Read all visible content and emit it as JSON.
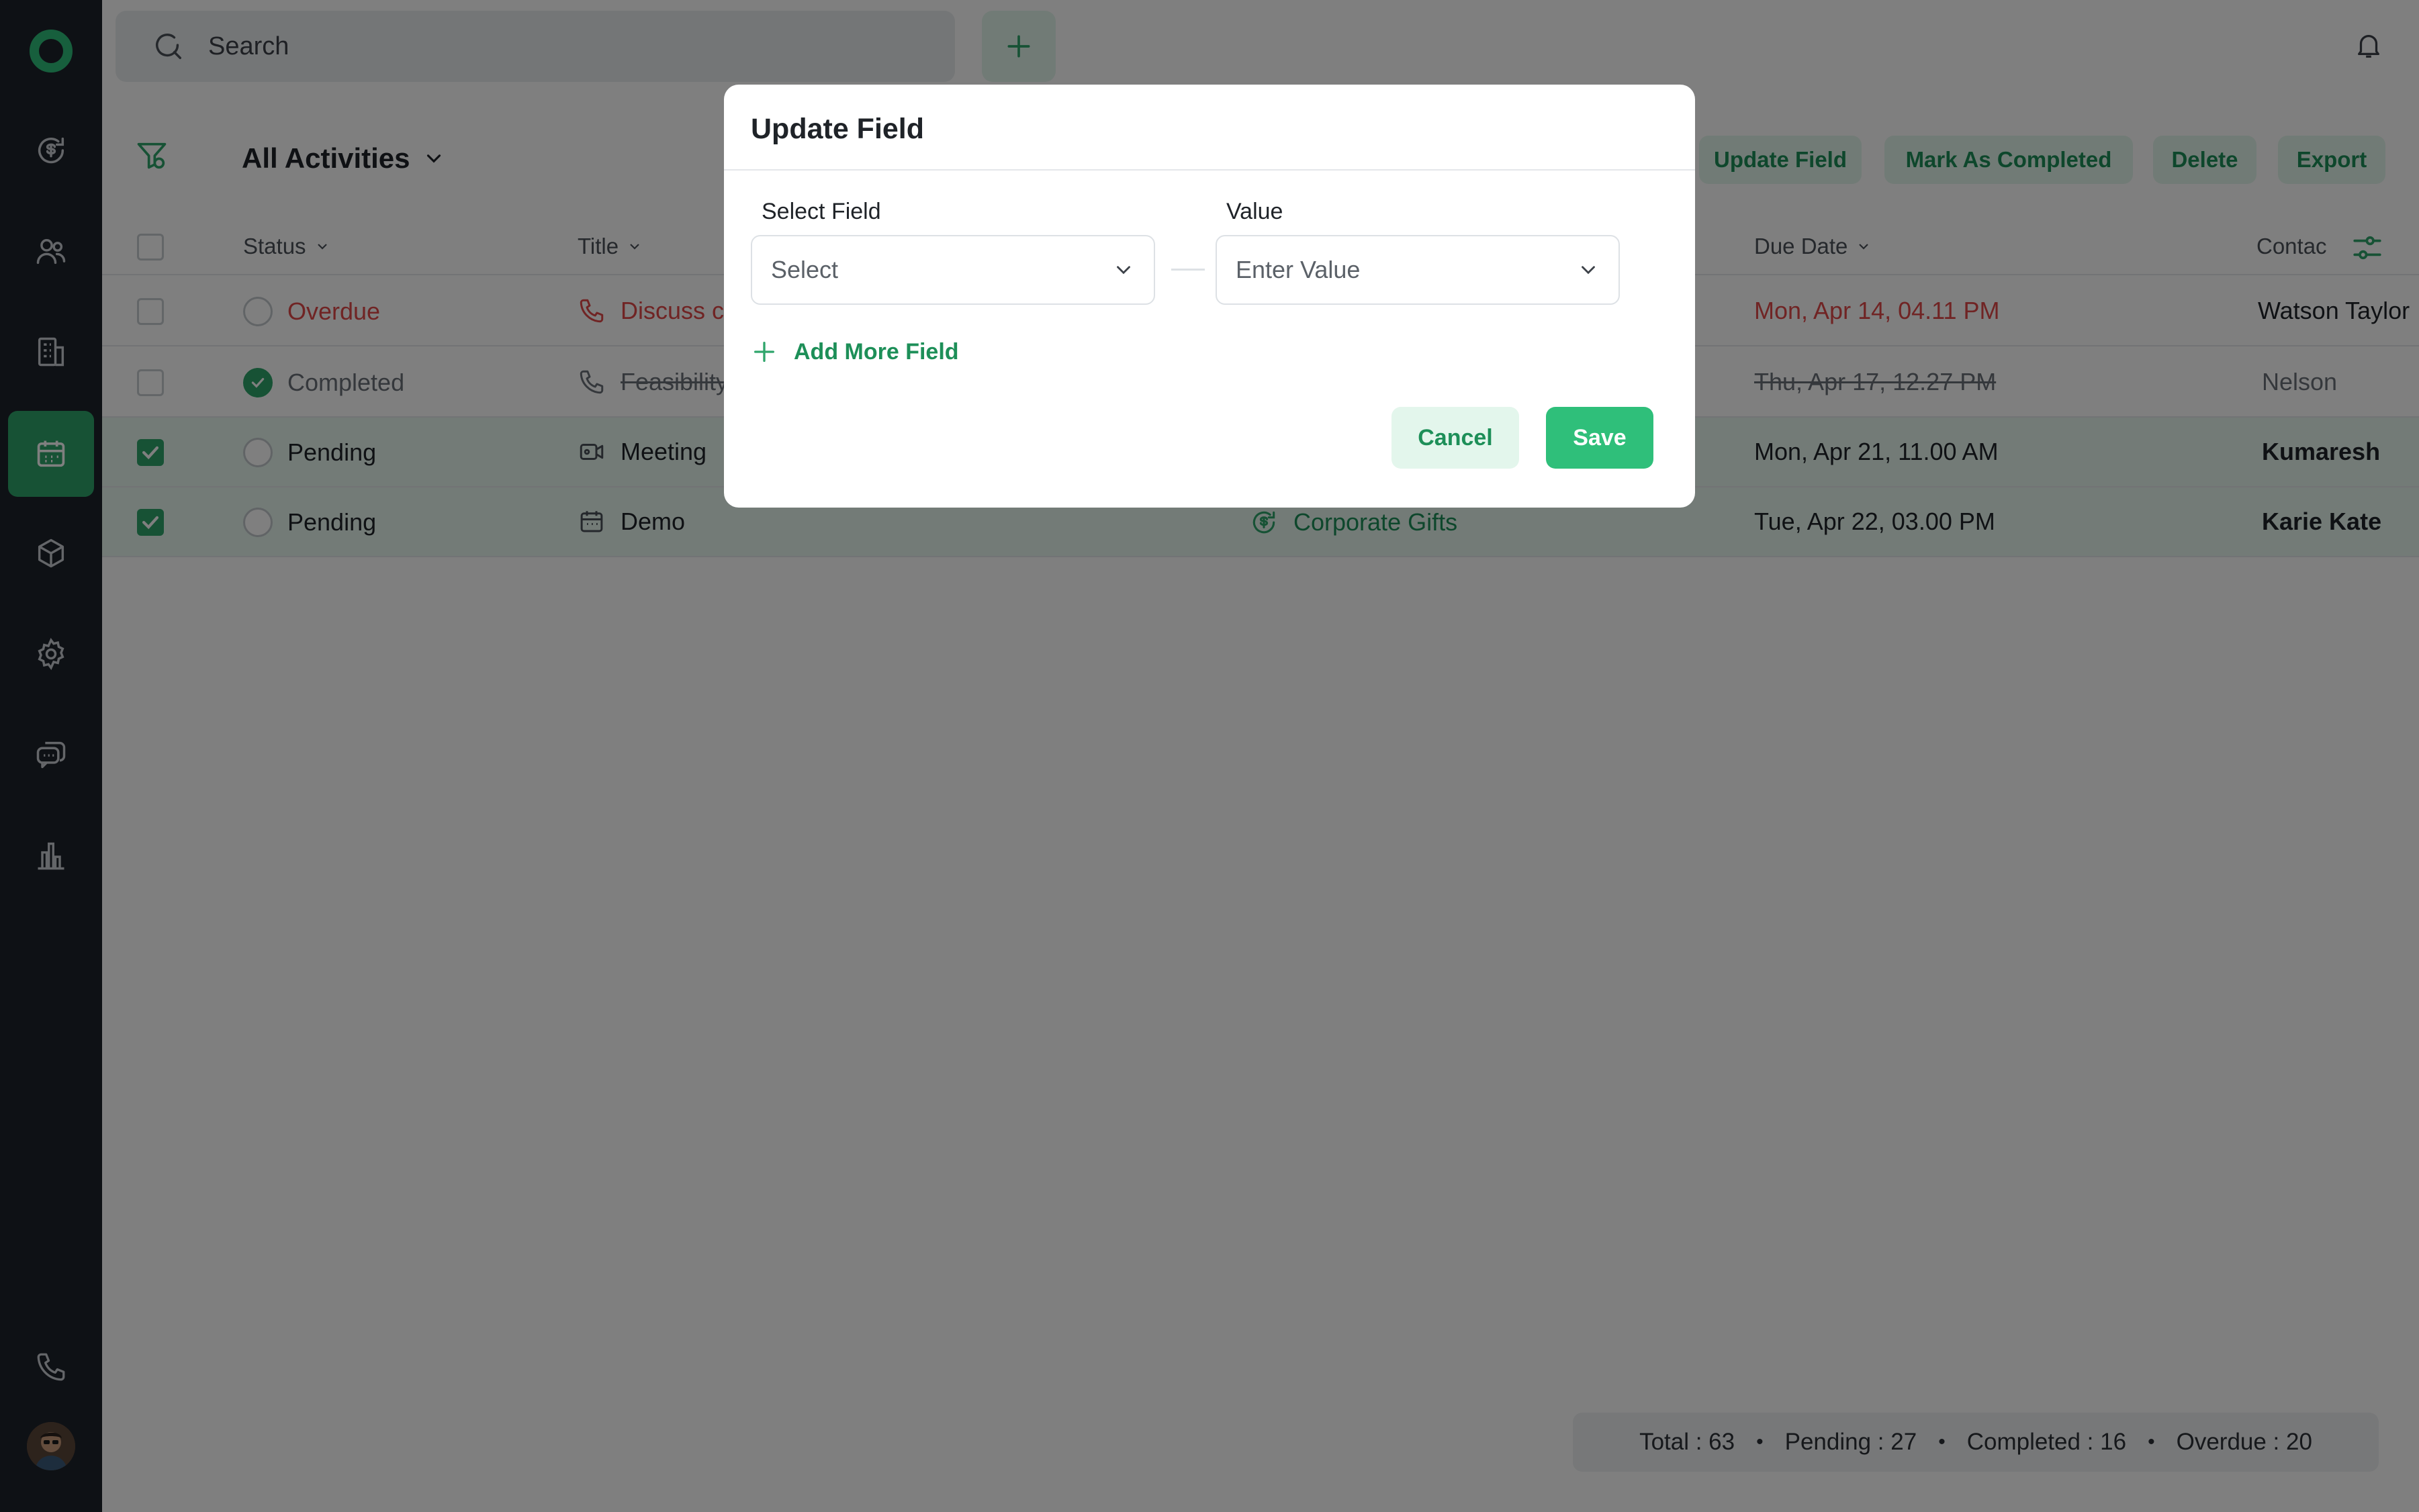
{
  "search": {
    "placeholder": "Search"
  },
  "toolbar": {
    "view_title": "All Activities",
    "update_field": "Update Field",
    "mark_completed": "Mark As Completed",
    "delete": "Delete",
    "export": "Export"
  },
  "table": {
    "headers": {
      "status": "Status",
      "title": "Title",
      "due_date": "Due Date",
      "contact": "Contac"
    },
    "rows": [
      {
        "status": "Overdue",
        "title": "Discuss c",
        "related": "",
        "due": "Mon, Apr 14, 04.11 PM",
        "contact": "Watson Taylor",
        "selected": false
      },
      {
        "status": "Completed",
        "title": "Feasibility",
        "related": "",
        "due": "Thu, Apr 17, 12.27 PM",
        "contact": "Nelson",
        "selected": false
      },
      {
        "status": "Pending",
        "title": "Meeting",
        "related": "",
        "due": "Mon, Apr 21, 11.00 AM",
        "contact": "Kumaresh",
        "selected": true
      },
      {
        "status": "Pending",
        "title": "Demo",
        "related": "Corporate Gifts",
        "due": "Tue, Apr 22, 03.00 PM",
        "contact": "Karie Kate",
        "selected": true
      }
    ]
  },
  "stats": {
    "total": "Total : 63",
    "pending": "Pending : 27",
    "completed": "Completed : 16",
    "overdue": "Overdue : 20"
  },
  "modal": {
    "title": "Update Field",
    "select_field_label": "Select Field",
    "select_placeholder": "Select",
    "value_label": "Value",
    "value_placeholder": "Enter Value",
    "add_more": "Add More Field",
    "cancel": "Cancel",
    "save": "Save"
  },
  "colors": {
    "accent": "#2fbf7a",
    "accent_dark": "#1d8f58",
    "sidebar_bg": "#1d222a",
    "overdue": "#e04848"
  },
  "icons": {
    "sidebar": [
      "logo",
      "dollar-refresh-icon",
      "contacts-icon",
      "company-icon",
      "calendar-icon",
      "box-icon",
      "gear-icon",
      "chat-icon",
      "chart-icon",
      "phone-icon"
    ]
  }
}
